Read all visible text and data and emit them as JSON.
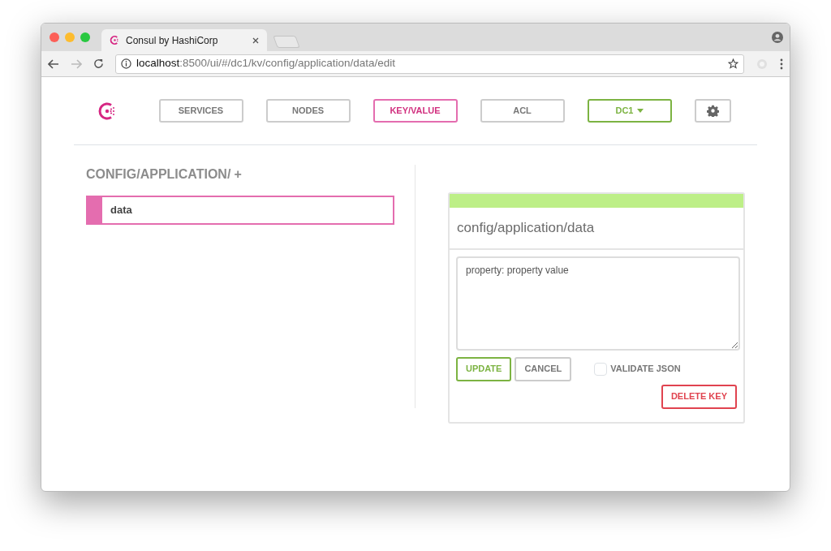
{
  "browser": {
    "tab_title": "Consul by HashiCorp",
    "url": {
      "host": "localhost",
      "path": ":8500/ui/#/dc1/kv/config/application/data/edit"
    }
  },
  "nav": [
    {
      "kind": "button",
      "label": "SERVICES",
      "selected": false
    },
    {
      "kind": "button",
      "label": "NODES",
      "selected": false
    },
    {
      "kind": "button",
      "label": "KEY/VALUE",
      "selected": true
    },
    {
      "kind": "button",
      "label": "ACL",
      "selected": false
    },
    {
      "kind": "dropdown",
      "label": "DC1",
      "selected": false
    },
    {
      "kind": "settings",
      "selected": false
    }
  ],
  "breadcrumb": {
    "path": "CONFIG/APPLICATION/",
    "add": "+"
  },
  "keys": [
    {
      "name": "data",
      "selected": true
    }
  ],
  "editor": {
    "title": "config/application/data",
    "value": "property: property value",
    "validate_json": {
      "label": "VALIDATE JSON",
      "checked": false
    },
    "buttons": [
      {
        "kind": "success",
        "label": "UPDATE"
      },
      {
        "kind": "default",
        "label": "CANCEL"
      },
      {
        "kind": "danger",
        "label": "DELETE KEY"
      }
    ]
  }
}
